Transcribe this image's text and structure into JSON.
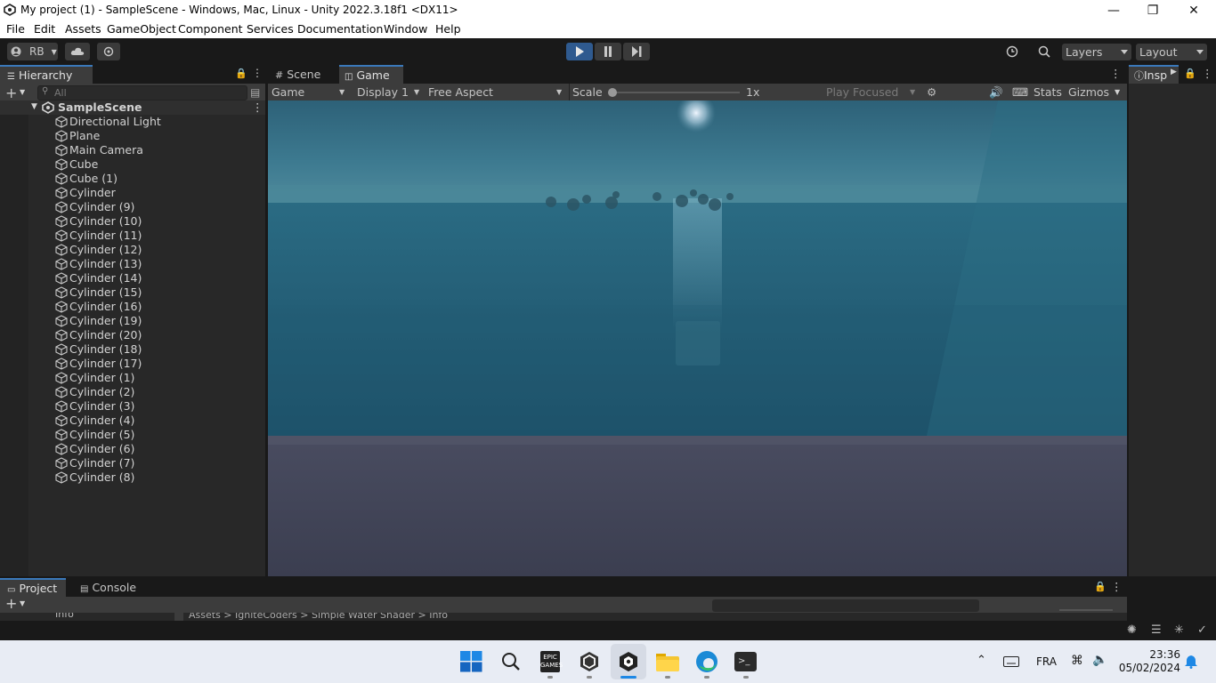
{
  "window": {
    "title": "My project (1) - SampleScene - Windows, Mac, Linux - Unity 2022.3.18f1 <DX11>",
    "minimize_icon": "minimize-icon",
    "maximize_icon": "restore-icon",
    "close_icon": "close-icon"
  },
  "menu": {
    "items": [
      "File",
      "Edit",
      "Assets",
      "GameObject",
      "Component",
      "Services",
      "Documentation",
      "Window",
      "Help"
    ]
  },
  "toolbar": {
    "account_label": "RB",
    "layers_label": "Layers",
    "layout_label": "Layout",
    "play_active": true
  },
  "hierarchy": {
    "tab_label": "Hierarchy",
    "search_placeholder": "All",
    "scene_name": "SampleScene",
    "items": [
      "Directional Light",
      "Plane",
      "Main Camera",
      "Cube",
      "Cube (1)",
      "Cylinder",
      "Cylinder (9)",
      "Cylinder (10)",
      "Cylinder (11)",
      "Cylinder (12)",
      "Cylinder (13)",
      "Cylinder (14)",
      "Cylinder (15)",
      "Cylinder (16)",
      "Cylinder (19)",
      "Cylinder (20)",
      "Cylinder (18)",
      "Cylinder (17)",
      "Cylinder (1)",
      "Cylinder (2)",
      "Cylinder (3)",
      "Cylinder (4)",
      "Cylinder (5)",
      "Cylinder (6)",
      "Cylinder (7)",
      "Cylinder (8)"
    ]
  },
  "game_view": {
    "tabs": [
      "Scene",
      "Game"
    ],
    "active_tab": "Game",
    "mode": "Game",
    "display": "Display 1",
    "aspect": "Free Aspect",
    "scale_label": "Scale",
    "scale_value": "1x",
    "play_focus": "Play Focused",
    "stats_label": "Stats",
    "gizmos_label": "Gizmos"
  },
  "inspector": {
    "tab_label": "Insp"
  },
  "bottom": {
    "tabs": [
      "Project",
      "Console"
    ],
    "folder_label": "Info",
    "breadcrumb": "Assets > IgniteCoders > Simple Water Shader > Info"
  },
  "taskbar": {
    "language": "FRA",
    "time": "23:36",
    "date": "05/02/2024",
    "apps": [
      "start-icon",
      "search-icon",
      "epic-games-icon",
      "unity-hub-icon",
      "unity-editor-icon",
      "file-explorer-icon",
      "edge-icon",
      "terminal-icon"
    ]
  },
  "colors": {
    "accent": "#3a79bb",
    "play_active": "#2f5a8f",
    "panel": "#282828",
    "dark": "#191919"
  }
}
